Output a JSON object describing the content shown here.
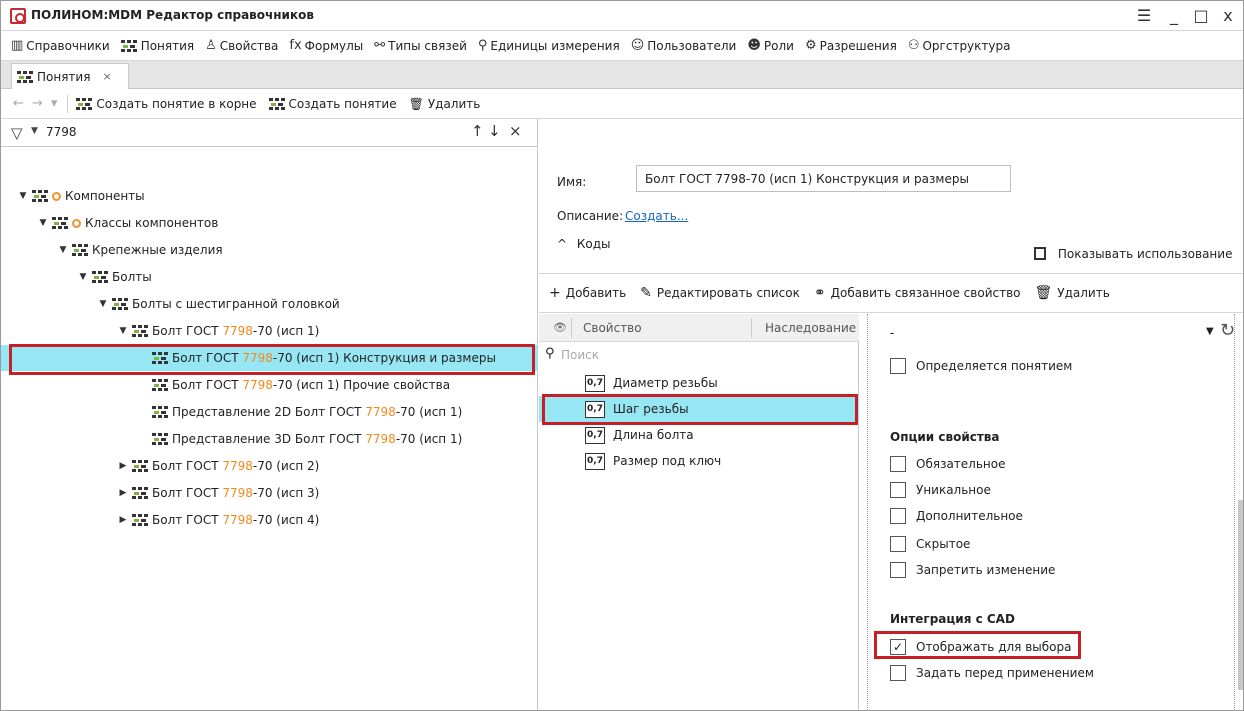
{
  "window": {
    "title": "ПОЛИНОМ:MDM Редактор справочников",
    "controls": {
      "menu": "☰",
      "minimize": "_",
      "maximize": "□",
      "close": "x"
    }
  },
  "main_menu": [
    {
      "label": "Справочники",
      "icon": "books-icon",
      "glyph": "▥"
    },
    {
      "label": "Понятия",
      "icon": "concept-icon",
      "glyph": ""
    },
    {
      "label": "Свойства",
      "icon": "properties-icon",
      "glyph": "♙"
    },
    {
      "label": "Формулы",
      "icon": "formula-icon",
      "glyph": "fx"
    },
    {
      "label": "Типы связей",
      "icon": "link-icon",
      "glyph": "⚯"
    },
    {
      "label": "Единицы измерения",
      "icon": "units-icon",
      "glyph": "⚲"
    },
    {
      "label": "Пользователи",
      "icon": "user-icon",
      "glyph": "☺"
    },
    {
      "label": "Роли",
      "icon": "roles-icon",
      "glyph": "☻"
    },
    {
      "label": "Разрешения",
      "icon": "permissions-icon",
      "glyph": "⚙"
    },
    {
      "label": "Оргструктура",
      "icon": "org-icon",
      "glyph": "⚇"
    }
  ],
  "tabs": [
    {
      "label": "Понятия",
      "close": "×"
    }
  ],
  "toolbar": {
    "back": "←",
    "forward": "→",
    "dropdown": "▾",
    "create_root": "Создать понятие в корне",
    "create": "Создать понятие",
    "delete": "Удалить"
  },
  "filter": {
    "value": "7798",
    "up": "↑",
    "down": "↓",
    "clear": "×"
  },
  "tree": [
    {
      "pre": "Компоненты",
      "hl": "",
      "post": "",
      "level": 0,
      "arrow": "▼",
      "orange": true
    },
    {
      "pre": "Классы компонентов",
      "hl": "",
      "post": "",
      "level": 1,
      "arrow": "▼",
      "orange": true
    },
    {
      "pre": "Крепежные изделия",
      "hl": "",
      "post": "",
      "level": 2,
      "arrow": "▼",
      "orange": false
    },
    {
      "pre": "Болты",
      "hl": "",
      "post": "",
      "level": 3,
      "arrow": "▼",
      "orange": false
    },
    {
      "pre": "Болты с шестигранной головкой",
      "hl": "",
      "post": "",
      "level": 4,
      "arrow": "▼",
      "orange": false
    },
    {
      "pre": "Болт ГОСТ ",
      "hl": "7798",
      "post": "-70 (исп 1)",
      "level": 5,
      "arrow": "▼",
      "orange": false
    },
    {
      "pre": "Болт ГОСТ ",
      "hl": "7798",
      "post": "-70 (исп 1) Конструкция и размеры",
      "level": 6,
      "arrow": "",
      "orange": false,
      "selected": true
    },
    {
      "pre": "Болт ГОСТ ",
      "hl": "7798",
      "post": "-70 (исп 1) Прочие свойства",
      "level": 6,
      "arrow": "",
      "orange": false
    },
    {
      "pre": "Представление 2D Болт ГОСТ ",
      "hl": "7798",
      "post": "-70 (исп 1)",
      "level": 6,
      "arrow": "",
      "orange": false
    },
    {
      "pre": "Представление 3D Болт ГОСТ ",
      "hl": "7798",
      "post": "-70 (исп 1)",
      "level": 6,
      "arrow": "",
      "orange": false
    },
    {
      "pre": "Болт ГОСТ ",
      "hl": "7798",
      "post": "-70 (исп 2)",
      "level": 5,
      "arrow": "▶",
      "orange": false
    },
    {
      "pre": "Болт ГОСТ ",
      "hl": "7798",
      "post": "-70 (исп 3)",
      "level": 5,
      "arrow": "▶",
      "orange": false
    },
    {
      "pre": "Болт ГОСТ ",
      "hl": "7798",
      "post": "-70 (исп 4)",
      "level": 5,
      "arrow": "▶",
      "orange": false
    }
  ],
  "details": {
    "name_label": "Имя:",
    "name_value": "Болт ГОСТ 7798-70 (исп 1) Конструкция и размеры",
    "desc_label": "Описание:",
    "desc_link": "Создать...",
    "codes_label": "Коды",
    "codes_arrow": "^",
    "usage_label": "Показывать использование"
  },
  "props_toolbar": {
    "add": "Добавить",
    "edit_list": "Редактировать список",
    "add_linked": "Добавить связанное свойство",
    "delete": "Удалить"
  },
  "props_table": {
    "col_property": "Свойство",
    "col_inherit": "Наследование",
    "search_placeholder": "Поиск",
    "type_badge": "0,7",
    "rows": [
      "Диаметр резьбы",
      "Шаг резьбы",
      "Длина болта",
      "Размер под ключ"
    ],
    "selected_index": 1
  },
  "options": {
    "top_value": "-",
    "defined_by_concept": "Определяется понятием",
    "section_options": "Опции свойства",
    "opt_required": "Обязательное",
    "opt_unique": "Уникальное",
    "opt_additional": "Дополнительное",
    "opt_hidden": "Скрытое",
    "opt_forbid_change": "Запретить изменение",
    "section_cad": "Интеграция с CAD",
    "cad_show_for_select": "Отображать для выбора",
    "cad_show_checked": true,
    "cad_set_before_apply": "Задать перед применением"
  },
  "colors": {
    "selection": "#97e6f3",
    "highlight": "#f08a1c",
    "annotation_box": "#c62026"
  }
}
